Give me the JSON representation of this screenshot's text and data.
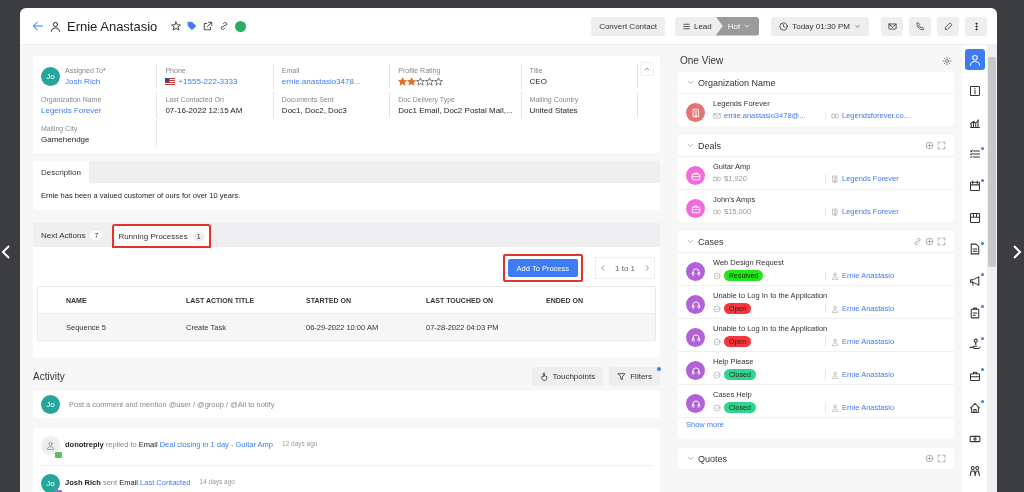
{
  "header": {
    "title": "Ernie Anastasio",
    "convert_button": "Convert Contact",
    "stage": {
      "label": "Lead",
      "value": "Hot"
    },
    "schedule": "Today 01:30 PM"
  },
  "fields": [
    {
      "label": "Assigned To",
      "required_mark": "*",
      "kind": "user",
      "avatar": "Jo",
      "value": "Josh Rich"
    },
    {
      "label": "Phone",
      "kind": "phone",
      "value": "+1555-222-3333"
    },
    {
      "label": "Email",
      "kind": "link",
      "value": "ernie.anastasio3478..."
    },
    {
      "label": "Profile Rating",
      "kind": "rating",
      "stars": 2
    },
    {
      "label": "Title",
      "kind": "text",
      "value": "CEO"
    },
    {
      "label": "Organization Name",
      "kind": "link",
      "value": "Legends Forever"
    },
    {
      "label": "Last Contacted On",
      "kind": "text",
      "value": "07-16-2022 12:15 AM"
    },
    {
      "label": "Documents Sent",
      "kind": "text",
      "value": "Doc1, Doc2, Doc3"
    },
    {
      "label": "Doc Delivery Type",
      "kind": "text",
      "value": "Doc1 Email, Doc2 Postal Mail,..."
    },
    {
      "label": "Mailing Country",
      "kind": "text",
      "value": "United States"
    },
    {
      "label": "Mailing City",
      "kind": "text",
      "value": "Gamehendge"
    }
  ],
  "description": {
    "tab": "Description",
    "text": "Ernie has been a valued customer of ours for over 10 years."
  },
  "process_tabs": [
    {
      "label": "Next Actions",
      "count": "7",
      "selected": false,
      "highlighted": false
    },
    {
      "label": "Running Processes",
      "count": "1",
      "selected": true,
      "highlighted": true
    }
  ],
  "add_button": {
    "label": "Add To Process",
    "highlighted": true
  },
  "pagination": "1 to 1",
  "table": {
    "columns": [
      "NAME",
      "LAST ACTION TITLE",
      "STARTED ON",
      "LAST TOUCHED ON",
      "ENDED ON"
    ],
    "rows": [
      {
        "cells": [
          "Sequence 5",
          "Create Task",
          "06-29-2022 10:00 AM",
          "07-28-2022 04:03 PM"
        ]
      }
    ]
  },
  "activity": {
    "title": "Activity",
    "touchpoints": "Touchpoints",
    "filters": "Filters",
    "comment_avatar": "Jo",
    "comment_placeholder": "Post a comment and mention @user / @group / @All to notify",
    "items": [
      {
        "kind": "system",
        "actor": "donotreply",
        "action": "replied to",
        "object": "Email",
        "link": "Deal closing in 1 day - Guitar Amp",
        "time": "12 days ago",
        "color": "#5cc05c"
      },
      {
        "kind": "user",
        "avatar": "Jo",
        "actor": "Josh Rich",
        "action": "sent",
        "object": "Email",
        "link": "Last Contacted",
        "time": "14 days ago",
        "color": "#a56ad6"
      }
    ]
  },
  "one_view": {
    "title": "One View",
    "sections": [
      {
        "kind": "organization",
        "title": "Organization Name",
        "items": [
          {
            "name": "Legends Forever",
            "email": "ernie.anastasio3478@...",
            "website": "Legendsforever.co..."
          }
        ]
      },
      {
        "kind": "deals",
        "title": "Deals",
        "items": [
          {
            "name": "Guitar Amp",
            "amount": "$1,920",
            "organization": "Legends Forever"
          },
          {
            "name": "John's Amps",
            "amount": "$15,000",
            "organization": "Legends Forever"
          }
        ]
      },
      {
        "kind": "cases",
        "title": "Cases",
        "show_more": "Show more",
        "items": [
          {
            "name": "Web Design Request",
            "status": "Resolved",
            "color": "#22e51a",
            "contact": "Ernie Anastasio"
          },
          {
            "name": "Unable to Log In to the Application",
            "status": "Open",
            "color": "#f5363c",
            "contact": "Ernie Anastasio"
          },
          {
            "name": "Unable to Log In to the Application",
            "status": "Open",
            "color": "#f5363c",
            "contact": "Ernie Anastasio"
          },
          {
            "name": "Help Please",
            "status": "Closed",
            "color": "#2fd58f",
            "contact": "Ernie Anastasio"
          },
          {
            "name": "Cases Help",
            "status": "Closed",
            "color": "#2fd58f",
            "contact": "Ernie Anastasio"
          }
        ]
      },
      {
        "kind": "quotes",
        "title": "Quotes"
      }
    ]
  },
  "side_icons": [
    {
      "kind": "person",
      "selected": true,
      "dot": false
    },
    {
      "kind": "info",
      "selected": false,
      "dot": false
    },
    {
      "kind": "chart",
      "selected": false,
      "dot": false
    },
    {
      "kind": "checklist",
      "selected": false,
      "dot": true
    },
    {
      "kind": "calendar",
      "selected": false,
      "dot": true
    },
    {
      "kind": "box",
      "selected": false,
      "dot": false
    },
    {
      "kind": "document",
      "selected": false,
      "dot": true
    },
    {
      "kind": "megaphone",
      "selected": false,
      "dot": true
    },
    {
      "kind": "clipboard",
      "selected": false,
      "dot": true
    },
    {
      "kind": "hand",
      "selected": false,
      "dot": true
    },
    {
      "kind": "briefcase",
      "selected": false,
      "dot": true
    },
    {
      "kind": "house",
      "selected": false,
      "dot": true
    },
    {
      "kind": "money",
      "selected": false,
      "dot": false
    },
    {
      "kind": "people",
      "selected": false,
      "dot": false
    }
  ]
}
